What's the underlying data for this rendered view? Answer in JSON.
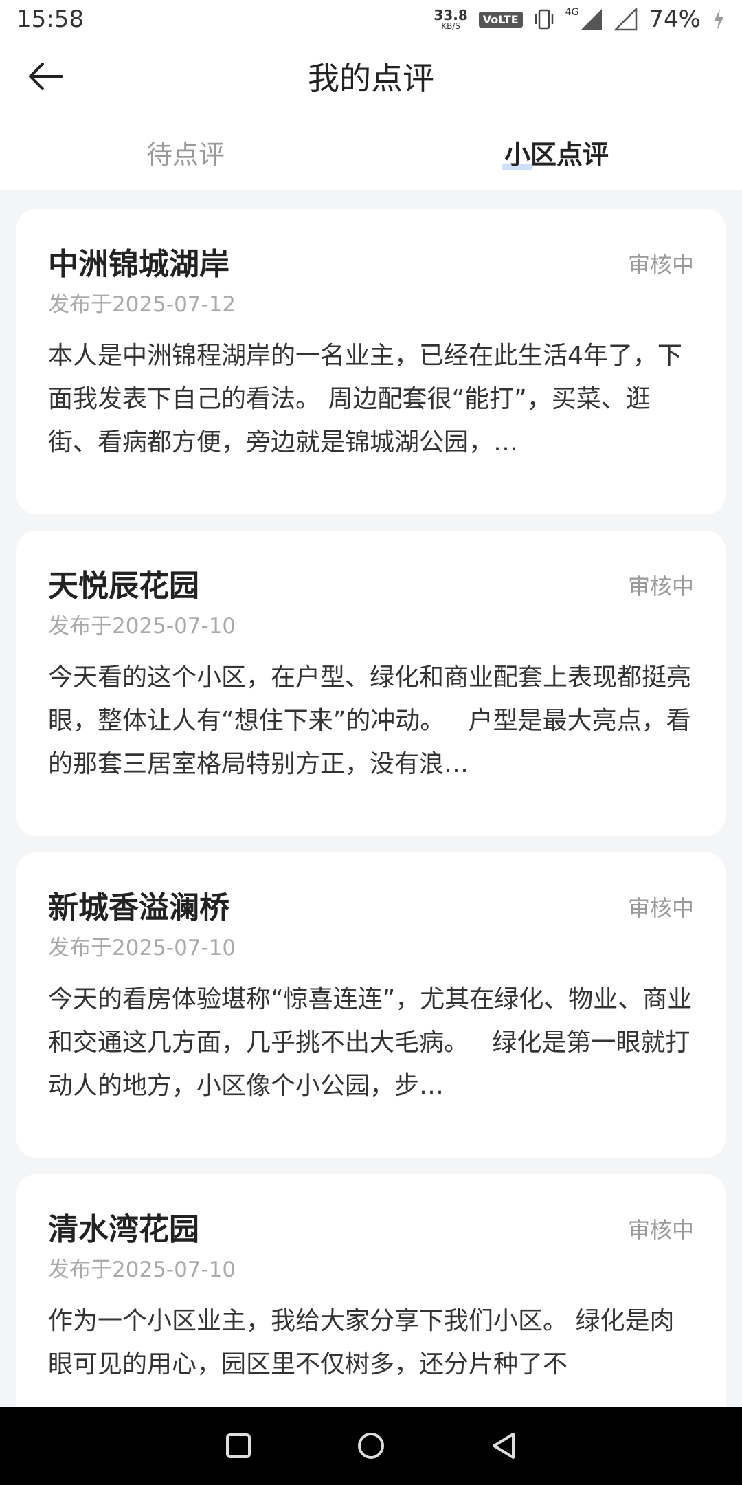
{
  "status_bar": {
    "time": "15:58",
    "speed_value": "33.8",
    "speed_unit": "KB/S",
    "volte": "VoLTE",
    "network": "4G",
    "battery": "74%"
  },
  "header": {
    "title": "我的点评"
  },
  "tabs": [
    {
      "label": "待点评",
      "active": false
    },
    {
      "label": "小区点评",
      "active": true
    }
  ],
  "reviews": [
    {
      "title": "中洲锦城湖岸",
      "status": "审核中",
      "date": "发布于2025-07-12",
      "body": "本人是中洲锦程湖岸的一名业主，已经在此生活4年了，下面我发表下自己的看法。 周边配套很“能打”，买菜、逛街、看病都方便，旁边就是锦城湖公园，…"
    },
    {
      "title": "天悦辰花园",
      "status": "审核中",
      "date": "发布于2025-07-10",
      "body": "今天看的这个小区，在户型、绿化和商业配套上表现都挺亮眼，整体让人有“想住下来”的冲动。   户型是最大亮点，看的那套三居室格局特别方正，没有浪…"
    },
    {
      "title": "新城香溢澜桥",
      "status": "审核中",
      "date": "发布于2025-07-10",
      "body": "今天的看房体验堪称“惊喜连连”，尤其在绿化、物业、商业和交通这几方面，几乎挑不出大毛病。   绿化是第一眼就打动人的地方，小区像个小公园，步…"
    },
    {
      "title": "清水湾花园",
      "status": "审核中",
      "date": "发布于2025-07-10",
      "body": "作为一个小区业主，我给大家分享下我们小区。 绿化是肉眼可见的用心，园区里不仅树多，还分片种了不"
    }
  ]
}
